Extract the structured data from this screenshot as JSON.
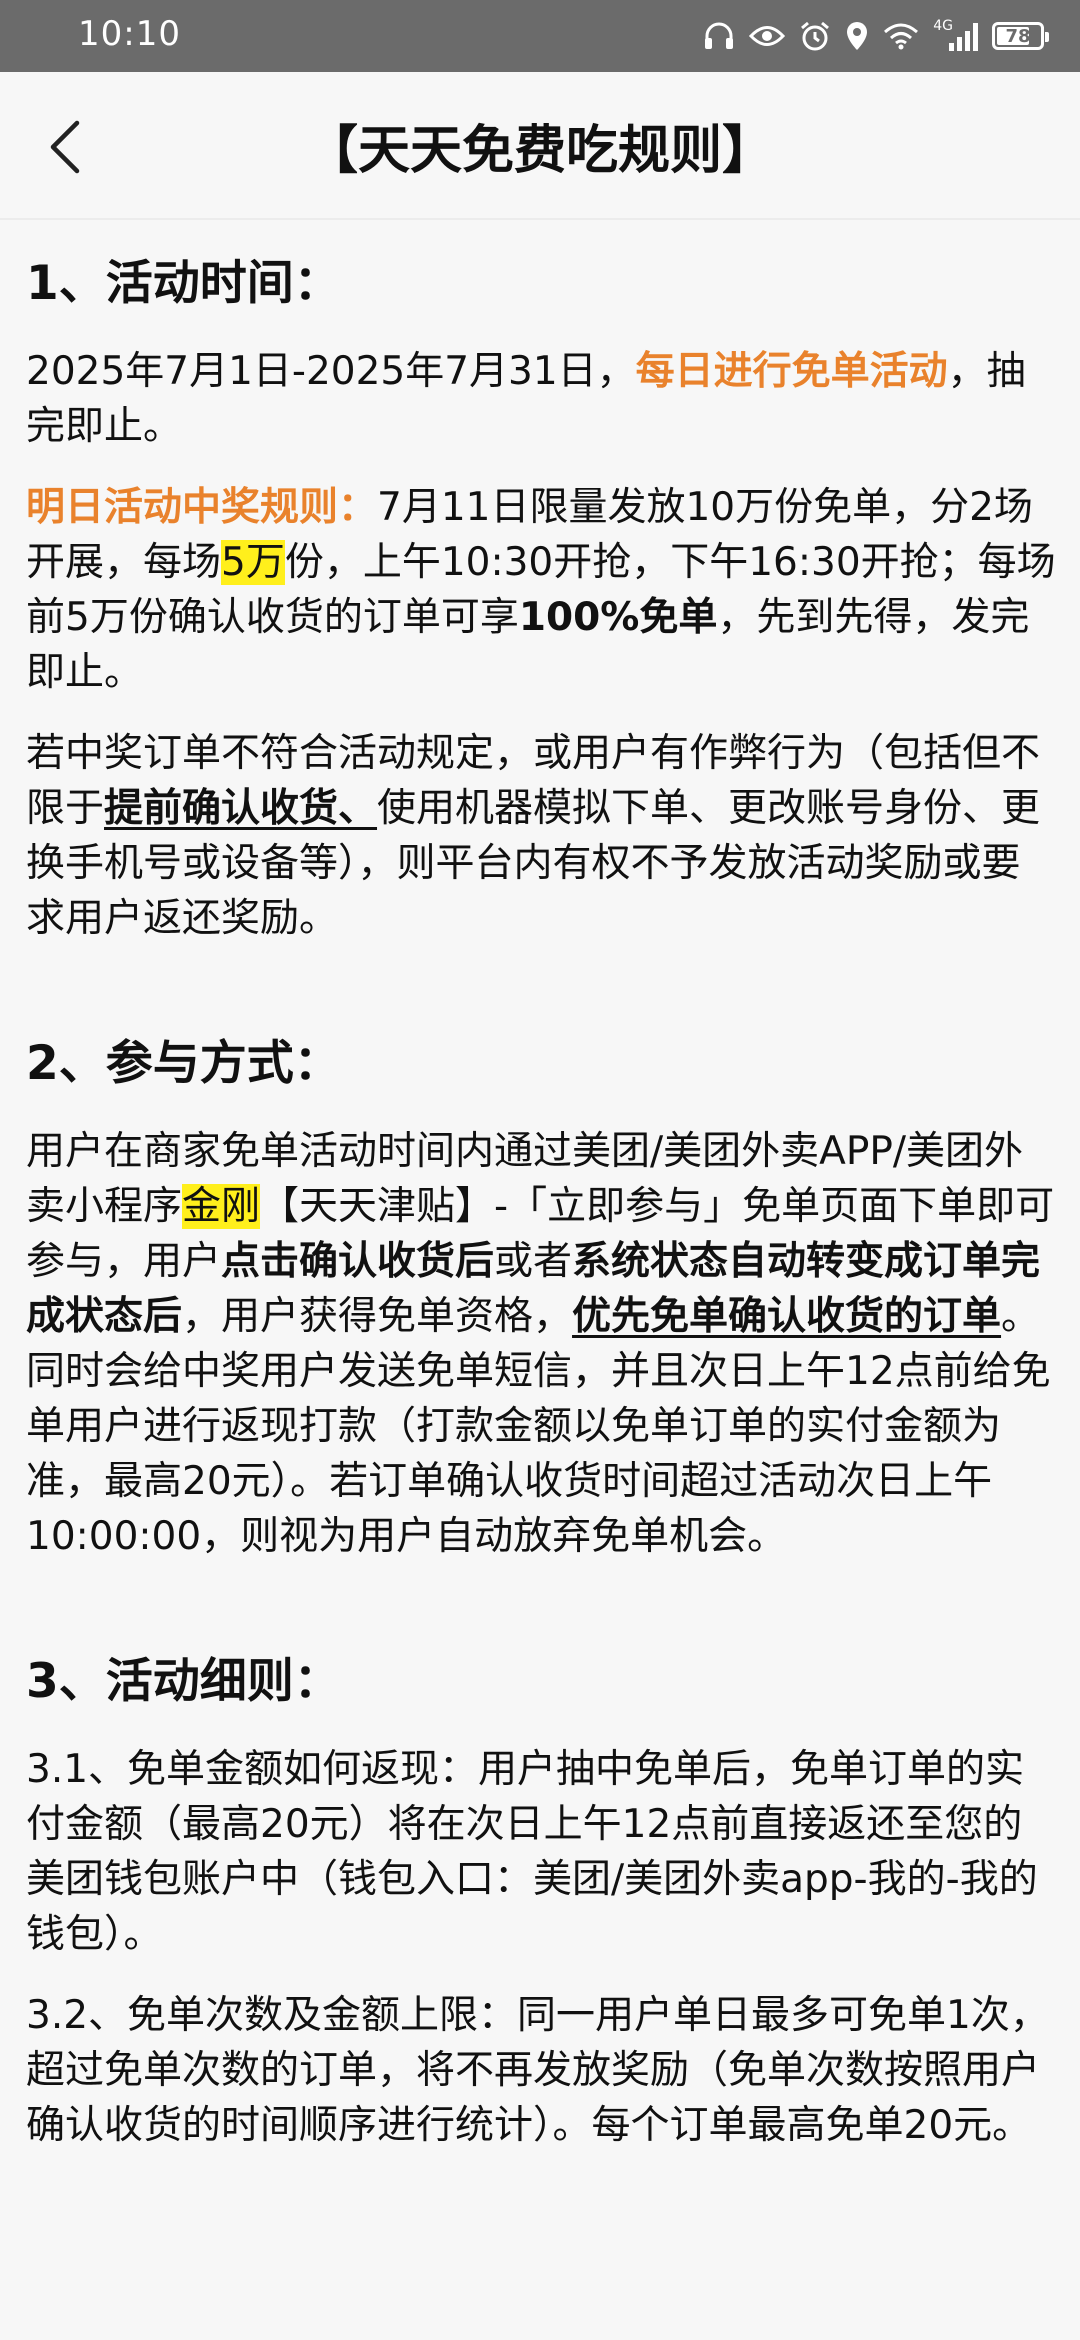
{
  "status_bar": {
    "time": "10:10",
    "network": "4G",
    "battery": "78",
    "battery_level": 0.78,
    "icons": [
      "headphones-icon",
      "eye-icon",
      "alarm-icon",
      "location-icon",
      "wifi-icon",
      "signal-icon",
      "battery-icon"
    ]
  },
  "header": {
    "title": "【天天免费吃规则】",
    "back_icon": "chevron-left-icon"
  },
  "colors": {
    "accent_orange": "#e9822c",
    "highlight_yellow": "#ffef1c",
    "status_bar_bg": "#6b6b6b"
  },
  "sections": [
    {
      "title": "1、活动时间：",
      "paragraphs": [
        {
          "segments": [
            {
              "text": "2025年7月1日-2025年7月31日，",
              "style": "plain"
            },
            {
              "text": "每日进行免单活动",
              "style": "orange"
            },
            {
              "text": "，抽完即止。",
              "style": "plain"
            }
          ]
        },
        {
          "segments": [
            {
              "text": "明日活动中奖规则：",
              "style": "orange"
            },
            {
              "text": "7月11日限量发放10万份免单，分2场开展，每场",
              "style": "plain"
            },
            {
              "text": "5万",
              "style": "highlight"
            },
            {
              "text": "份，上午10:30开抢，下午16:30开抢；每场前5万份确认收货的订单可享",
              "style": "plain"
            },
            {
              "text": "100%免单",
              "style": "bold"
            },
            {
              "text": "，先到先得，发完即止。",
              "style": "plain"
            }
          ]
        },
        {
          "segments": [
            {
              "text": "若中奖订单不符合活动规定，或用户有作弊行为（包括但不限于",
              "style": "plain"
            },
            {
              "text": "提前确认收货、",
              "style": "bold-underline"
            },
            {
              "text": "使用机器模拟下单、更改账号身份、更换手机号或设备等），则平台内有权不予发放活动奖励或要求用户返还奖励。",
              "style": "plain"
            }
          ]
        }
      ]
    },
    {
      "title": "2、参与方式：",
      "paragraphs": [
        {
          "segments": [
            {
              "text": "用户在商家免单活动时间内通过美团/美团外卖APP/美团外卖小程序",
              "style": "plain"
            },
            {
              "text": "金刚",
              "style": "highlight"
            },
            {
              "text": "【天天津贴】-「立即参与」免单页面下单即可参与，用户",
              "style": "plain"
            },
            {
              "text": "点击确认收货后",
              "style": "bold"
            },
            {
              "text": "或者",
              "style": "plain"
            },
            {
              "text": "系统状态自动转变成订单完成状态后",
              "style": "bold"
            },
            {
              "text": "，用户获得免单资格，",
              "style": "plain"
            },
            {
              "text": "优先免单确认收货的订单",
              "style": "bold-underline"
            },
            {
              "text": "。同时会给中奖用户发送免单短信，并且次日上午12点前给免单用户进行返现打款（打款金额以免单订单的实付金额为准，最高20元）。若订单确认收货时间超过活动次日上午10:00:00，则视为用户自动放弃免单机会。",
              "style": "plain"
            }
          ]
        }
      ]
    },
    {
      "title": "3、活动细则：",
      "paragraphs": [
        {
          "segments": [
            {
              "text": "3.1、免单金额如何返现：用户抽中免单后，免单订单的实付金额（最高20元）将在次日上午12点前直接返还至您的美团钱包账户中（钱包入口：美团/美团外卖app-我的-我的钱包）。",
              "style": "plain"
            }
          ]
        },
        {
          "segments": [
            {
              "text": "3.2、免单次数及金额上限：同一用户单日最多可免单1次，超过免单次数的订单，将不再发放奖励（免单次数按照用户确认收货的时间顺序进行统计）。每个订单最高免单20元。",
              "style": "plain"
            }
          ]
        }
      ]
    }
  ]
}
